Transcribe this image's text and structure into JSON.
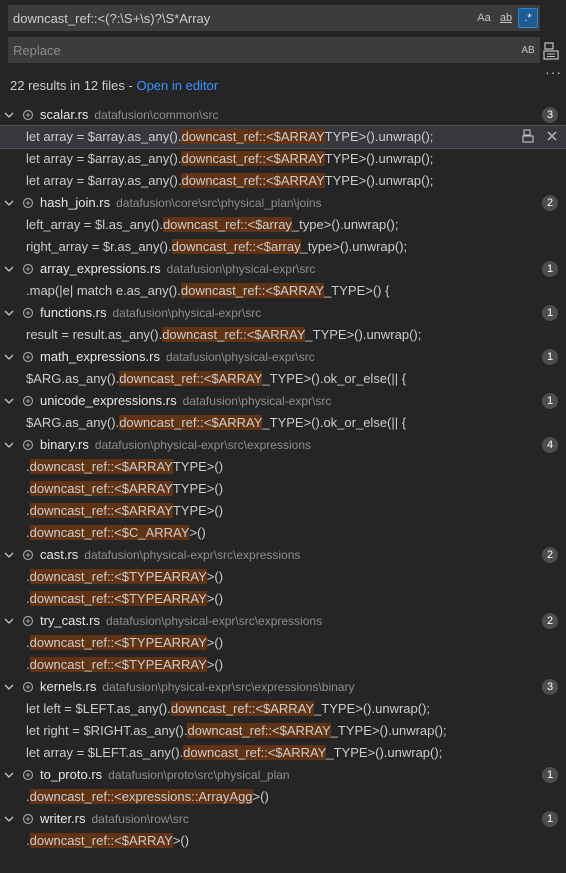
{
  "search": {
    "query": "downcast_ref::<(?:\\S+\\s)?\\S*Array",
    "match_case_label": "Aa",
    "whole_word_label": "ab",
    "regex_label": ".*"
  },
  "replace": {
    "placeholder": "Replace",
    "preserve_case_label": "AB"
  },
  "summary": {
    "text": "22 results in 12 files - ",
    "open_editor": "Open in editor"
  },
  "files": [
    {
      "name": "scalar.rs",
      "path": "datafusion\\common\\src",
      "count": "3",
      "matches": [
        {
          "pre": "let array = $array.as_any().",
          "hl": "downcast_ref::<$ARRAY",
          "post": "TYPE>().unwrap();"
        },
        {
          "pre": "let array = $array.as_any().",
          "hl": "downcast_ref::<$ARRAY",
          "post": "TYPE>().unwrap();"
        },
        {
          "pre": "let array = $array.as_any().",
          "hl": "downcast_ref::<$ARRAY",
          "post": "TYPE>().unwrap();"
        }
      ]
    },
    {
      "name": "hash_join.rs",
      "path": "datafusion\\core\\src\\physical_plan\\joins",
      "count": "2",
      "matches": [
        {
          "pre": "left_array = $l.as_any().",
          "hl": "downcast_ref::<$array",
          "post": "_type>().unwrap();"
        },
        {
          "pre": "right_array = $r.as_any().",
          "hl": "downcast_ref::<$array",
          "post": "_type>().unwrap();"
        }
      ]
    },
    {
      "name": "array_expressions.rs",
      "path": "datafusion\\physical-expr\\src",
      "count": "1",
      "matches": [
        {
          "pre": ".map(|e| match e.as_any().",
          "hl": "downcast_ref::<$ARRAY",
          "post": "_TYPE>() {"
        }
      ]
    },
    {
      "name": "functions.rs",
      "path": "datafusion\\physical-expr\\src",
      "count": "1",
      "matches": [
        {
          "pre": "result = result.as_any().",
          "hl": "downcast_ref::<$ARRAY",
          "post": "_TYPE>().unwrap();"
        }
      ]
    },
    {
      "name": "math_expressions.rs",
      "path": "datafusion\\physical-expr\\src",
      "count": "1",
      "matches": [
        {
          "pre": "$ARG.as_any().",
          "hl": "downcast_ref::<$ARRAY",
          "post": "_TYPE>().ok_or_else(|| {"
        }
      ]
    },
    {
      "name": "unicode_expressions.rs",
      "path": "datafusion\\physical-expr\\src",
      "count": "1",
      "matches": [
        {
          "pre": "$ARG.as_any().",
          "hl": "downcast_ref::<$ARRAY",
          "post": "_TYPE>().ok_or_else(|| {"
        }
      ]
    },
    {
      "name": "binary.rs",
      "path": "datafusion\\physical-expr\\src\\expressions",
      "count": "4",
      "matches": [
        {
          "pre": ".",
          "hl": "downcast_ref::<$ARRAY",
          "post": "TYPE>()"
        },
        {
          "pre": ".",
          "hl": "downcast_ref::<$ARRAY",
          "post": "TYPE>()"
        },
        {
          "pre": ".",
          "hl": "downcast_ref::<$ARRAY",
          "post": "TYPE>()"
        },
        {
          "pre": ".",
          "hl": "downcast_ref::<$C_ARRAY",
          "post": ">()"
        }
      ]
    },
    {
      "name": "cast.rs",
      "path": "datafusion\\physical-expr\\src\\expressions",
      "count": "2",
      "matches": [
        {
          "pre": ".",
          "hl": "downcast_ref::<$TYPEARRAY",
          "post": ">()"
        },
        {
          "pre": ".",
          "hl": "downcast_ref::<$TYPEARRAY",
          "post": ">()"
        }
      ]
    },
    {
      "name": "try_cast.rs",
      "path": "datafusion\\physical-expr\\src\\expressions",
      "count": "2",
      "matches": [
        {
          "pre": ".",
          "hl": "downcast_ref::<$TYPEARRAY",
          "post": ">()"
        },
        {
          "pre": ".",
          "hl": "downcast_ref::<$TYPEARRAY",
          "post": ">()"
        }
      ]
    },
    {
      "name": "kernels.rs",
      "path": "datafusion\\physical-expr\\src\\expressions\\binary",
      "count": "3",
      "matches": [
        {
          "pre": "let left = $LEFT.as_any().",
          "hl": "downcast_ref::<$ARRAY",
          "post": "_TYPE>().unwrap();"
        },
        {
          "pre": "let right = $RIGHT.as_any().",
          "hl": "downcast_ref::<$ARRAY",
          "post": "_TYPE>().unwrap();"
        },
        {
          "pre": "let array = $LEFT.as_any().",
          "hl": "downcast_ref::<$ARRAY",
          "post": "_TYPE>().unwrap();"
        }
      ]
    },
    {
      "name": "to_proto.rs",
      "path": "datafusion\\proto\\src\\physical_plan",
      "count": "1",
      "matches": [
        {
          "pre": ".",
          "hl": "downcast_ref::<expressions::ArrayAgg",
          "post": ">()"
        }
      ]
    },
    {
      "name": "writer.rs",
      "path": "datafusion\\row\\src",
      "count": "1",
      "matches": [
        {
          "pre": ".",
          "hl": "downcast_ref::<$ARRAY",
          "post": ">()"
        }
      ]
    }
  ]
}
